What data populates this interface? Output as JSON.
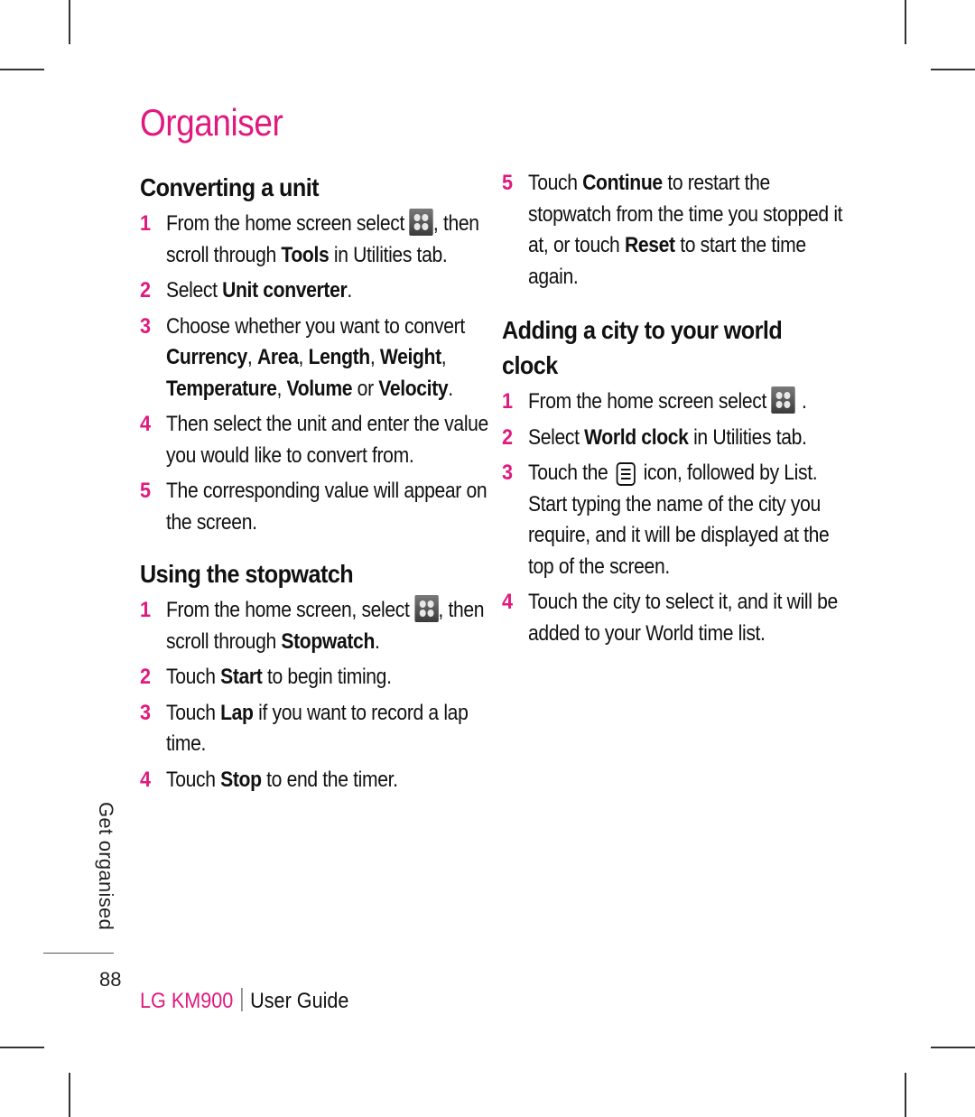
{
  "page": {
    "title": "Organiser",
    "side_tab": "Get organised",
    "page_number": "88",
    "footer": {
      "brand": "LG KM900",
      "guide": "User Guide"
    },
    "accent_color": "#e0197f"
  },
  "sections": {
    "converting": {
      "heading": "Converting a unit",
      "steps": [
        {
          "num": "1",
          "parts": [
            "From the home screen select ",
            ", then scroll through ",
            "Tools",
            " in Utilities tab."
          ]
        },
        {
          "num": "2",
          "parts": [
            "Select ",
            "Unit converter",
            "."
          ]
        },
        {
          "num": "3",
          "parts": [
            "Choose whether you want to convert ",
            "Currency",
            ", ",
            "Area",
            ", ",
            "Length",
            ", ",
            "Weight",
            ", ",
            "Temperature",
            ", ",
            "Volume",
            " or ",
            "Velocity",
            "."
          ]
        },
        {
          "num": "4",
          "text": "Then select the unit and enter the value you would like to convert from."
        },
        {
          "num": "5",
          "text": "The corresponding value will appear on the screen."
        }
      ]
    },
    "stopwatch": {
      "heading": "Using the stopwatch",
      "steps": [
        {
          "num": "1",
          "parts": [
            "From the home screen, select ",
            ", then scroll through ",
            "Stopwatch",
            "."
          ]
        },
        {
          "num": "2",
          "parts": [
            "Touch ",
            "Start",
            " to begin timing."
          ]
        },
        {
          "num": "3",
          "parts": [
            "Touch ",
            "Lap",
            " if you want to record a lap time."
          ]
        },
        {
          "num": "4",
          "parts": [
            "Touch ",
            "Stop",
            " to end the timer."
          ]
        },
        {
          "num": "5",
          "parts": [
            "Touch ",
            "Continue",
            " to restart the stopwatch from the time you stopped it at, or touch ",
            "Reset",
            " to start the time again."
          ]
        }
      ]
    },
    "world_clock": {
      "heading": "Adding a city to your world clock",
      "steps": [
        {
          "num": "1",
          "parts": [
            "From the home screen select ",
            "."
          ]
        },
        {
          "num": "2",
          "parts": [
            "Select ",
            "World clock",
            " in Utilities tab."
          ]
        },
        {
          "num": "3",
          "parts": [
            "Touch the ",
            " icon, followed by List. Start typing the name of the city you require, and it will be displayed at the top of the screen."
          ]
        },
        {
          "num": "4",
          "text": "Touch the city to select it, and it will be added to your World time list."
        }
      ]
    }
  },
  "icons": {
    "menu_grid": "menu-grid-icon",
    "options_menu": "options-menu-icon"
  }
}
